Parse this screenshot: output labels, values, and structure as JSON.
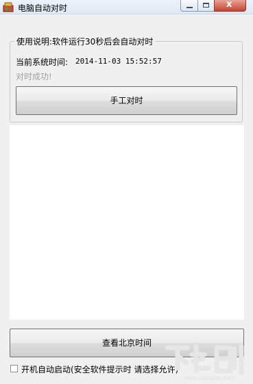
{
  "window": {
    "title": "电脑自动对时",
    "close_glyph": "x"
  },
  "group": {
    "legend": "使用说明:软件运行30秒后会自动对时",
    "time_label": "当前系统时间:",
    "time_value": "2014-11-03 15:52:57",
    "status": "对时成功!",
    "sync_button": "手工对时"
  },
  "beijing_button": "查看北京时间",
  "autostart_checkbox": {
    "label": "开机自动启动(安全软件提示时 请选择允许)",
    "checked": false
  },
  "watermark": {
    "text": "下载吧",
    "url": "www.xiazaiba.com"
  },
  "colors": {
    "status_text": "#a0a0a0",
    "close_button": "#c7432f"
  },
  "icons": [
    "app-icon",
    "minimize-icon",
    "maximize-icon",
    "close-icon"
  ]
}
